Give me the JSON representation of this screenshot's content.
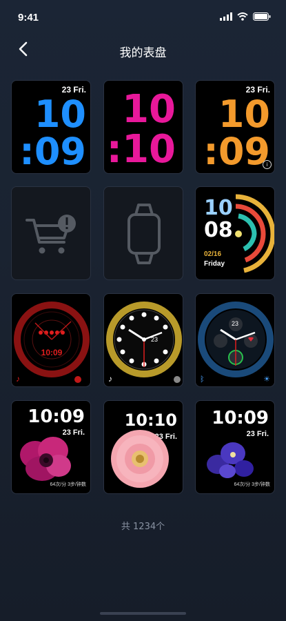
{
  "status": {
    "time": "9:41"
  },
  "nav": {
    "title": "我的表盘"
  },
  "faces": [
    {
      "date": "23 Fri.",
      "hour": "10",
      "minute": ":09",
      "color": "#1e8fff"
    },
    {
      "hour": "10",
      "minute": ":10",
      "color": "#e8189a"
    },
    {
      "date": "23 Fri.",
      "hour": "10",
      "minute": ":09",
      "color": "#f39a2c"
    },
    {
      "icon": "cart-error-icon"
    },
    {
      "icon": "watch-outline-icon"
    },
    {
      "hour": "10",
      "minute": "08",
      "date": "02/16",
      "day": "Friday"
    },
    {
      "time": "10:09",
      "color": "#e01e1e"
    },
    {
      "date": "23",
      "color": "#d8c24a"
    },
    {
      "date": "23",
      "color": "#4aa3ff"
    },
    {
      "time": "10:09",
      "date": "23 Fri.",
      "flower": "anemone",
      "caption": "64次/分  3步/钟数"
    },
    {
      "time": "10:10",
      "date": "23 Fri.",
      "flower": "gerbera"
    },
    {
      "time": "10:09",
      "date": "23 Fri.",
      "flower": "iris",
      "caption": "64次/分  3步/钟数"
    }
  ],
  "footer": {
    "count_text": "共 1234个"
  }
}
